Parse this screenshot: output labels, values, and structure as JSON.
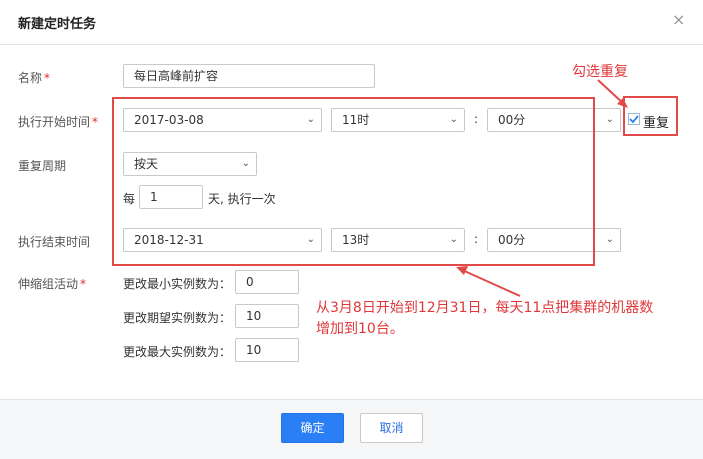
{
  "dialog": {
    "title": "新建定时任务",
    "close_glyph": "×"
  },
  "form": {
    "name_label": "名称",
    "required_mark": "*",
    "name_value": "每日高峰前扩容",
    "start_label": "执行开始时间",
    "start_date": "2017-03-08",
    "start_hour": "11时",
    "start_minute": "00分",
    "colon": ":",
    "repeat_checkbox_label": "重复",
    "repeat_checked": true,
    "cycle_label": "重复周期",
    "cycle_value": "按天",
    "every_prefix": "每",
    "every_value": "1",
    "every_suffix": "天, 执行一次",
    "end_label": "执行结束时间",
    "end_date": "2018-12-31",
    "end_hour": "13时",
    "end_minute": "00分",
    "scaling_label": "伸缩组活动",
    "min_label": "更改最小实例数为：",
    "min_value": "0",
    "desired_label": "更改期望实例数为：",
    "desired_value": "10",
    "max_label": "更改最大实例数为：",
    "max_value": "10"
  },
  "annotations": {
    "check_repeat": "勾选重复",
    "explanation_line1": "从3月8日开始到12月31日，每天11点把集群的机器数",
    "explanation_line2": "增加到10台。"
  },
  "footer": {
    "confirm": "确定",
    "cancel": "取消"
  },
  "colors": {
    "primary": "#2b7ff5",
    "annotation": "#e0383a",
    "check": "#2b7ff5"
  },
  "icons": {
    "dropdown": "chevron-down-icon",
    "close": "close-icon",
    "check": "check-icon"
  }
}
